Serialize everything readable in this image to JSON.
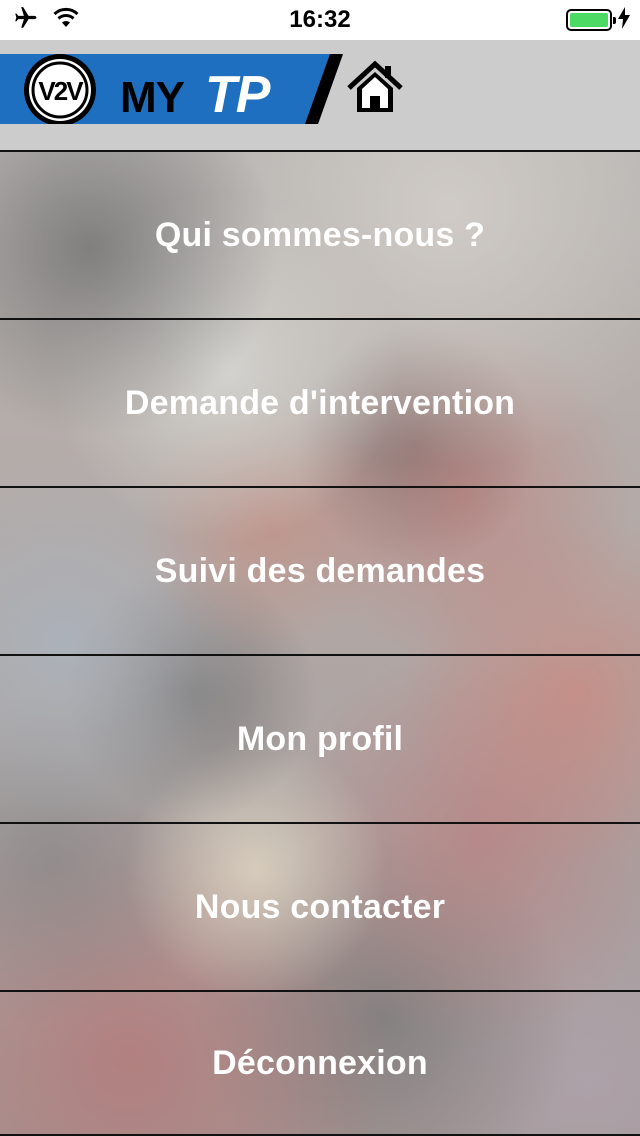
{
  "status_bar": {
    "time": "16:32",
    "icons": [
      "airplane-icon",
      "wifi-icon",
      "battery-icon",
      "charging-bolt-icon"
    ],
    "battery_color": "#4cd964"
  },
  "header": {
    "logo_badge": "V2V",
    "logo_text": "MYTP",
    "brand_color": "#1e6fbf",
    "home_icon": "home-icon"
  },
  "menu": {
    "items": [
      {
        "label": "Qui sommes-nous ?"
      },
      {
        "label": "Demande d'intervention"
      },
      {
        "label": "Suivi des demandes"
      },
      {
        "label": "Mon profil"
      },
      {
        "label": "Nous contacter"
      },
      {
        "label": "Déconnexion"
      }
    ]
  }
}
